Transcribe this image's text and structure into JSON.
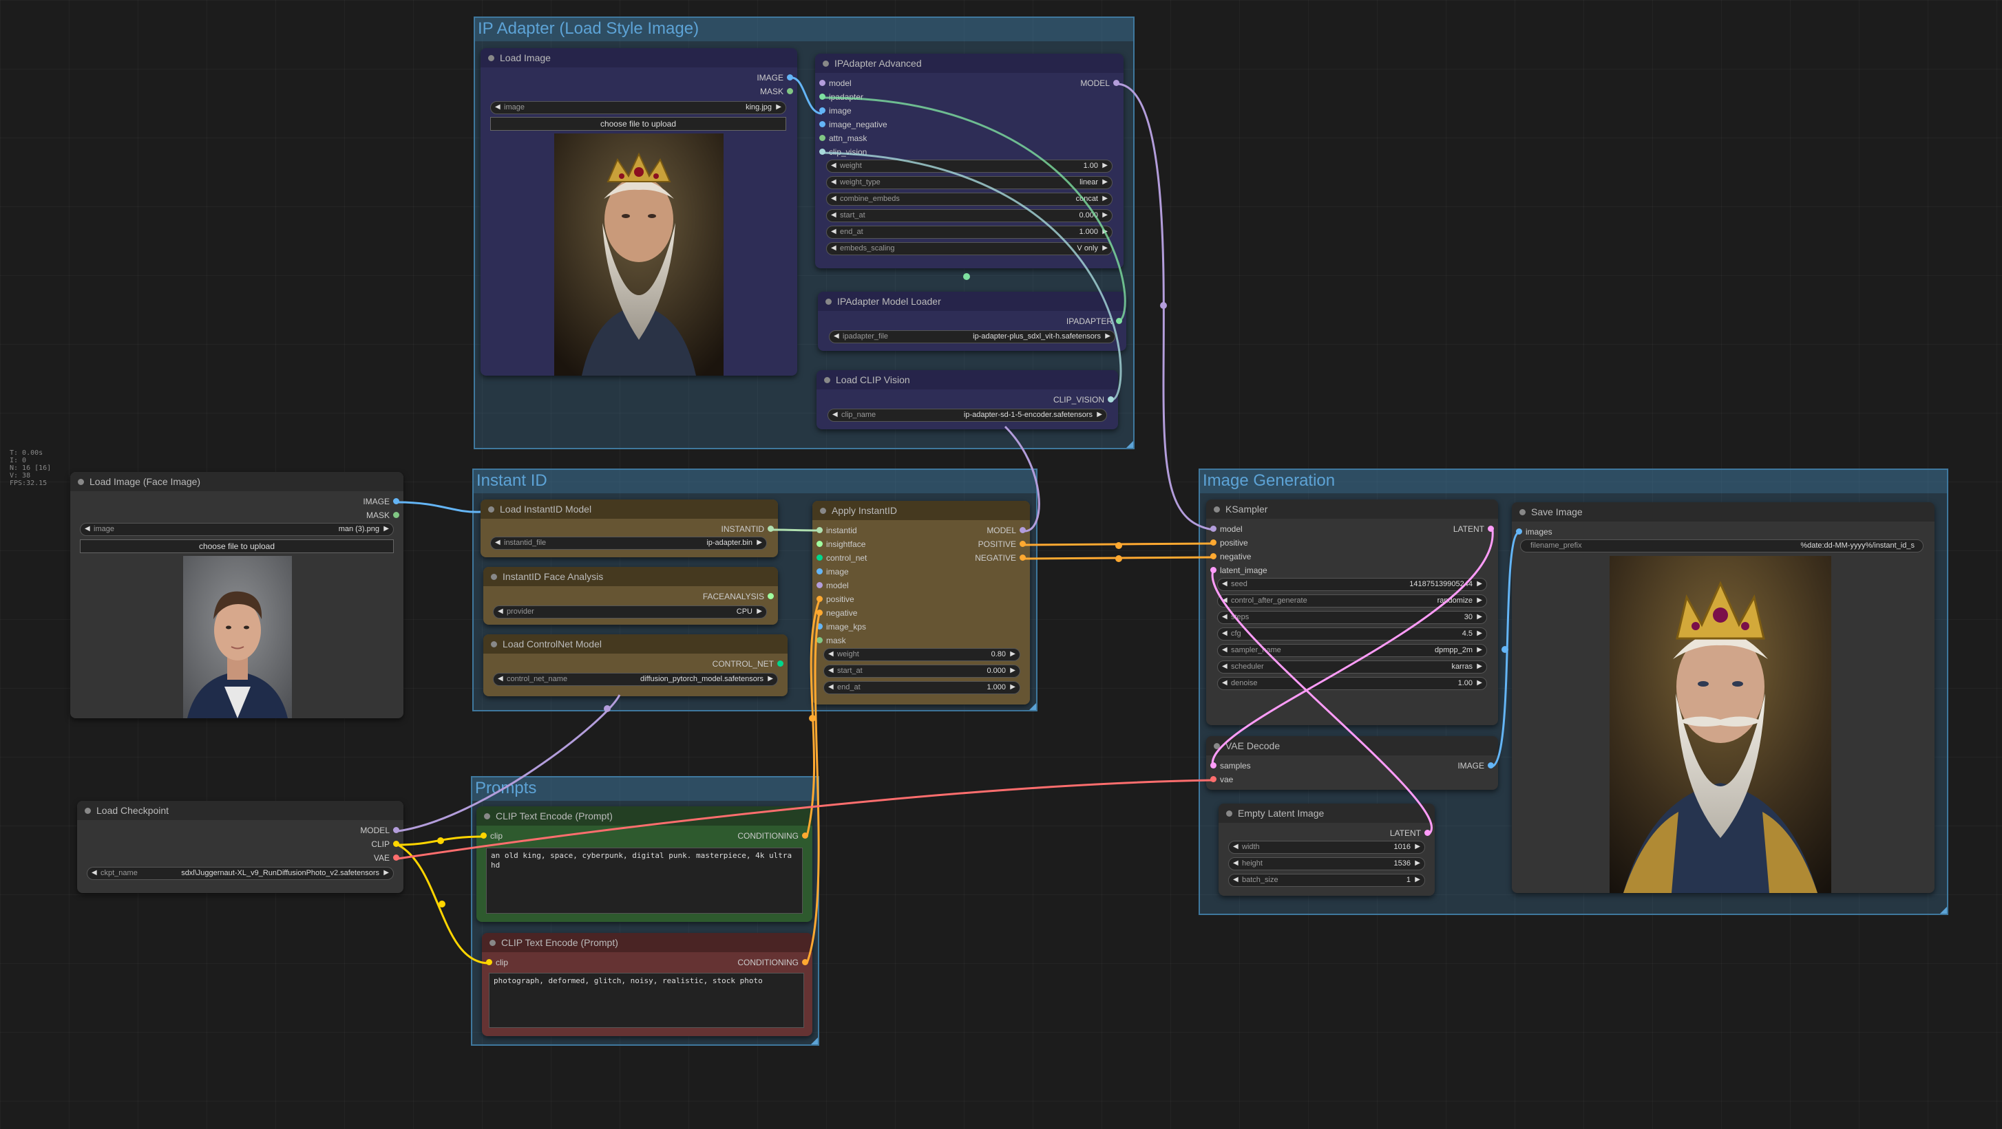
{
  "stats": {
    "time": "T: 0.00s",
    "i": "I: 0",
    "n": "N: 16 [16]",
    "v": "V: 38",
    "fps": "FPS:32.15"
  },
  "groups": {
    "ip_adapter": "IP Adapter (Load Style Image)",
    "instant_id": "Instant ID",
    "prompts": "Prompts",
    "image_generation": "Image Generation"
  },
  "nodes": {
    "load_image_style": {
      "title": "Load Image",
      "outputs": [
        "IMAGE",
        "MASK"
      ],
      "image_widget": {
        "name": "image",
        "value": "king.jpg"
      },
      "upload_button": "choose file to upload"
    },
    "ipadapter_advanced": {
      "title": "IPAdapter Advanced",
      "inputs": [
        "model",
        "ipadapter",
        "image",
        "image_negative",
        "attn_mask",
        "clip_vision"
      ],
      "output": "MODEL",
      "widgets": [
        {
          "name": "weight",
          "value": "1.00"
        },
        {
          "name": "weight_type",
          "value": "linear"
        },
        {
          "name": "combine_embeds",
          "value": "concat"
        },
        {
          "name": "start_at",
          "value": "0.000"
        },
        {
          "name": "end_at",
          "value": "1.000"
        },
        {
          "name": "embeds_scaling",
          "value": "V only"
        }
      ]
    },
    "ipadapter_loader": {
      "title": "IPAdapter Model Loader",
      "output": "IPADAPTER",
      "widget": {
        "name": "ipadapter_file",
        "value": "ip-adapter-plus_sdxl_vit-h.safetensors"
      }
    },
    "clip_vision_loader": {
      "title": "Load CLIP Vision",
      "output": "CLIP_VISION",
      "widget": {
        "name": "clip_name",
        "value": "ip-adapter-sd-1-5-encoder.safetensors"
      }
    },
    "load_image_face": {
      "title": "Load Image (Face Image)",
      "outputs": [
        "IMAGE",
        "MASK"
      ],
      "image_widget": {
        "name": "image",
        "value": "man (3).png"
      },
      "upload_button": "choose file to upload"
    },
    "instantid_loader": {
      "title": "Load InstantID Model",
      "output": "INSTANTID",
      "widget": {
        "name": "instantid_file",
        "value": "ip-adapter.bin"
      }
    },
    "face_analysis": {
      "title": "InstantID Face Analysis",
      "output": "FACEANALYSIS",
      "widget": {
        "name": "provider",
        "value": "CPU"
      }
    },
    "controlnet_loader": {
      "title": "Load ControlNet Model",
      "output": "CONTROL_NET",
      "widget": {
        "name": "control_net_name",
        "value": "diffusion_pytorch_model.safetensors"
      }
    },
    "apply_instantid": {
      "title": "Apply InstantID",
      "inputs": [
        "instantid",
        "insightface",
        "control_net",
        "image",
        "model",
        "positive",
        "negative",
        "image_kps",
        "mask"
      ],
      "outputs": [
        "MODEL",
        "POSITIVE",
        "NEGATIVE"
      ],
      "widgets": [
        {
          "name": "weight",
          "value": "0.80"
        },
        {
          "name": "start_at",
          "value": "0.000"
        },
        {
          "name": "end_at",
          "value": "1.000"
        }
      ]
    },
    "load_checkpoint": {
      "title": "Load Checkpoint",
      "outputs": [
        "MODEL",
        "CLIP",
        "VAE"
      ],
      "widget": {
        "name": "ckpt_name",
        "value": "sdxl\\Juggernaut-XL_v9_RunDiffusionPhoto_v2.safetensors"
      }
    },
    "clip_positive": {
      "title": "CLIP Text Encode (Prompt)",
      "input": "clip",
      "output": "CONDITIONING",
      "text": "an old king, space, cyberpunk, digital punk. masterpiece, 4k ultra hd"
    },
    "clip_negative": {
      "title": "CLIP Text Encode (Prompt)",
      "input": "clip",
      "output": "CONDITIONING",
      "text": "photograph, deformed, glitch, noisy, realistic, stock photo"
    },
    "ksampler": {
      "title": "KSampler",
      "inputs": [
        "model",
        "positive",
        "negative",
        "latent_image"
      ],
      "output": "LATENT",
      "widgets": [
        {
          "name": "seed",
          "value": "141875139905244"
        },
        {
          "name": "control_after_generate",
          "value": "randomize"
        },
        {
          "name": "steps",
          "value": "30"
        },
        {
          "name": "cfg",
          "value": "4.5"
        },
        {
          "name": "sampler_name",
          "value": "dpmpp_2m"
        },
        {
          "name": "scheduler",
          "value": "karras"
        },
        {
          "name": "denoise",
          "value": "1.00"
        }
      ]
    },
    "vae_decode": {
      "title": "VAE Decode",
      "inputs": [
        "samples",
        "vae"
      ],
      "output": "IMAGE"
    },
    "empty_latent": {
      "title": "Empty Latent Image",
      "output": "LATENT",
      "widgets": [
        {
          "name": "width",
          "value": "1016"
        },
        {
          "name": "height",
          "value": "1536"
        },
        {
          "name": "batch_size",
          "value": "1"
        }
      ]
    },
    "save_image": {
      "title": "Save Image",
      "input": "images",
      "widget": {
        "name": "filename_prefix",
        "value": "%date:dd-MM-yyyy%/instant_id_s"
      }
    }
  },
  "colors": {
    "model": "#b39ddb",
    "image": "#64b5f6",
    "clip": "#ffd500",
    "vae": "#ff6e6e",
    "conditioning": "#ffa931",
    "latent": "#ff9cf9",
    "group_border": "#3f789e"
  }
}
